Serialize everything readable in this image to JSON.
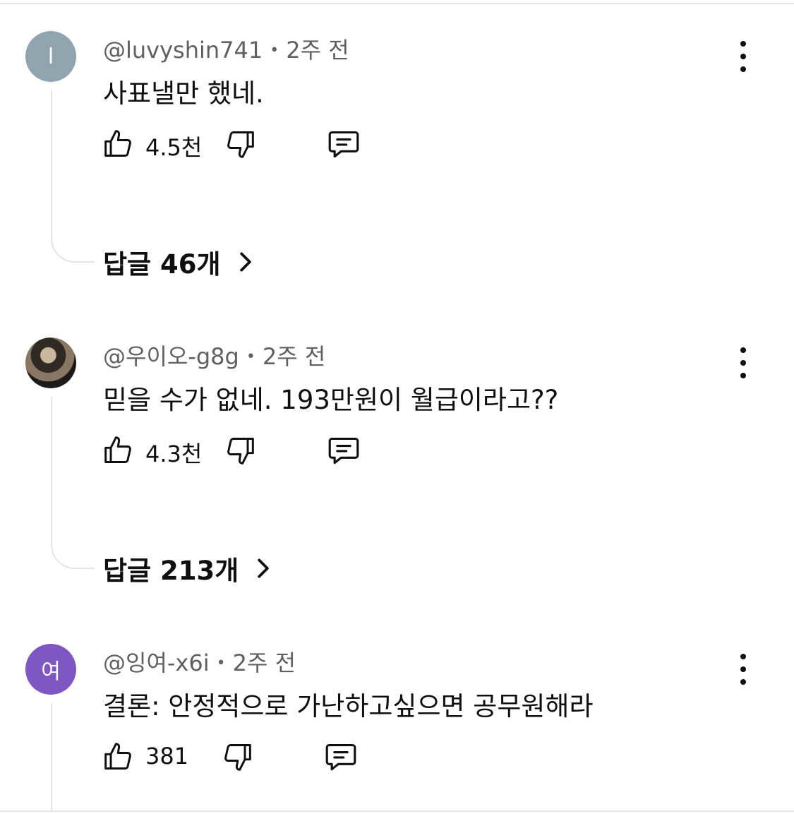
{
  "comments": [
    {
      "avatar_letter": "l",
      "avatar_color": "#90a4ae",
      "author": "@luvyshin741",
      "time": "2주 전",
      "text": "사표낼만 했네.",
      "likes": "4.5천",
      "replies_label": "답글 46개"
    },
    {
      "avatar_letter": "",
      "avatar_color": "#2f2a24",
      "author": "@우이오-g8g",
      "time": "2주 전",
      "text": "믿을 수가 없네. 193만원이 월급이라고??",
      "likes": "4.3천",
      "replies_label": "답글 213개"
    },
    {
      "avatar_letter": "여",
      "avatar_color": "#7e57c2",
      "author": "@잉여-x6i",
      "time": "2주 전",
      "text": "결론: 안정적으로 가난하고싶으면 공무원해라",
      "likes": "381"
    }
  ],
  "icons": {
    "like": "thumbs-up-icon",
    "dislike": "thumbs-down-icon",
    "reply": "comment-icon",
    "more": "more-vert-icon",
    "chevron": "chevron-right-icon"
  }
}
